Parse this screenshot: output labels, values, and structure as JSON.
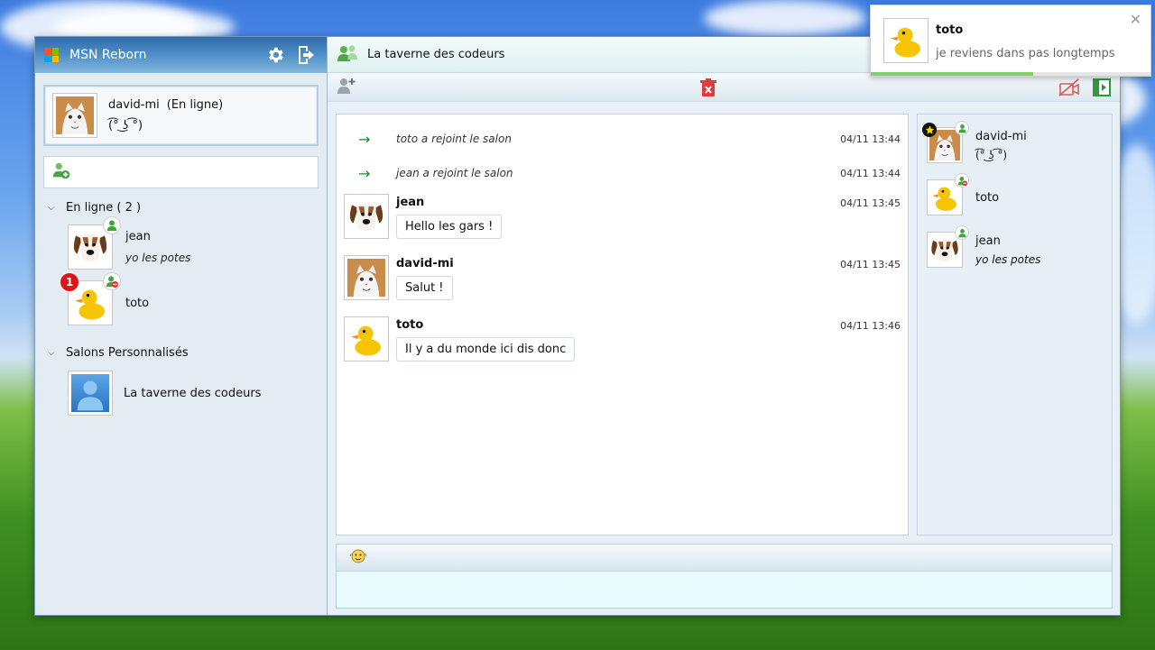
{
  "app": {
    "title": "MSN Reborn"
  },
  "profile": {
    "name": "david-mi",
    "status": "(En ligne)",
    "mood": "(͡° ͜ʖ ͡°)"
  },
  "contacts": {
    "online_group": "En ligne ( 2 )",
    "items": [
      {
        "name": "jean",
        "message": "yo les potes",
        "status": "online"
      },
      {
        "name": "toto",
        "message": "",
        "status": "busy",
        "unread": "1"
      }
    ],
    "rooms_group": "Salons Personnalisés",
    "rooms": [
      {
        "name": "La taverne des codeurs"
      }
    ]
  },
  "room": {
    "title": "La taverne des codeurs"
  },
  "messages": {
    "system": [
      {
        "text": "toto a rejoint le salon",
        "time": "04/11 13:44"
      },
      {
        "text": "jean a rejoint le salon",
        "time": "04/11 13:44"
      }
    ],
    "items": [
      {
        "author": "jean",
        "text": "Hello les gars !",
        "time": "04/11 13:45",
        "avatar": "dog"
      },
      {
        "author": "david-mi",
        "text": "Salut !",
        "time": "04/11 13:45",
        "avatar": "cat"
      },
      {
        "author": "toto",
        "text": "Il y a du monde ici dis donc",
        "time": "04/11 13:46",
        "avatar": "duck"
      }
    ]
  },
  "members": [
    {
      "name": "david-mi",
      "message": "(͡° ͜ʖ ͡°)",
      "avatar": "cat",
      "admin": true
    },
    {
      "name": "toto",
      "message": "",
      "avatar": "duck"
    },
    {
      "name": "jean",
      "message": "yo les potes",
      "avatar": "dog"
    }
  ],
  "notification": {
    "name": "toto",
    "message": "je reviens dans pas longtemps",
    "progress": 0.58
  },
  "colors": {
    "online": "#3fa83a",
    "busy": "#d9302a",
    "badge": "#e0141b",
    "accent": "#2f6aa8"
  },
  "icons": [
    "settings-icon",
    "logout-icon",
    "add-contact-icon",
    "add-member-icon",
    "delete-room-icon",
    "mute-icon",
    "close-panel-icon",
    "emoji-icon"
  ]
}
